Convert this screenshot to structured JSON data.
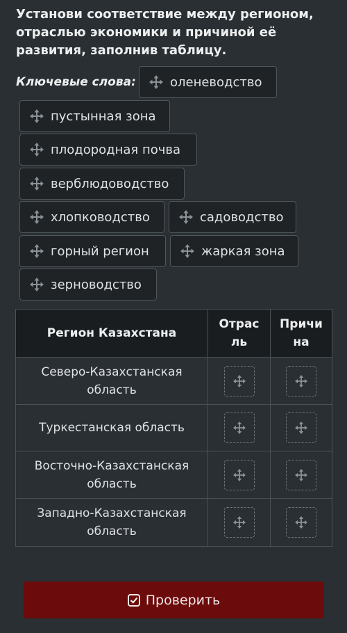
{
  "task": {
    "line1": "Установи соответствие между регионом,",
    "line2": "отраслью экономики и причиной её",
    "line3": "развития, заполнив таблицу."
  },
  "keywords_label": "Ключевые слова:",
  "keywords": [
    {
      "label": "оленеводство",
      "icon": "move-icon"
    },
    {
      "label": "пустынная зона",
      "icon": "move-icon"
    },
    {
      "label": "плодородная почва",
      "icon": "move-icon"
    },
    {
      "label": "верблюдоводство",
      "icon": "move-icon"
    },
    {
      "label": "хлопководство",
      "icon": "move-icon"
    },
    {
      "label": "садоводство",
      "icon": "move-icon"
    },
    {
      "label": "горный регион",
      "icon": "move-icon"
    },
    {
      "label": "жаркая зона",
      "icon": "move-icon"
    },
    {
      "label": "зерноводство",
      "icon": "move-icon"
    }
  ],
  "table": {
    "headers": {
      "region": "Регион Казахстана",
      "industry_l1": "Отрас",
      "industry_l2": "ль",
      "reason_l1": "Причи",
      "reason_l2": "на"
    },
    "rows": [
      {
        "l1": "Северо-Казахстанская",
        "l2": "область"
      },
      {
        "l1": "Туркестанская область",
        "l2": ""
      },
      {
        "l1": "Восточно-Казахстанская",
        "l2": "область"
      },
      {
        "l1": "Западно-Казахстанская",
        "l2": "область"
      }
    ]
  },
  "check_button": {
    "label": "Проверить",
    "icon": "checkbox-check-icon"
  },
  "colors": {
    "background": "#2a2f33",
    "header_bg": "#1a1d20",
    "chip_bg": "#1f2326",
    "button_bg": "#6b0b0b"
  }
}
